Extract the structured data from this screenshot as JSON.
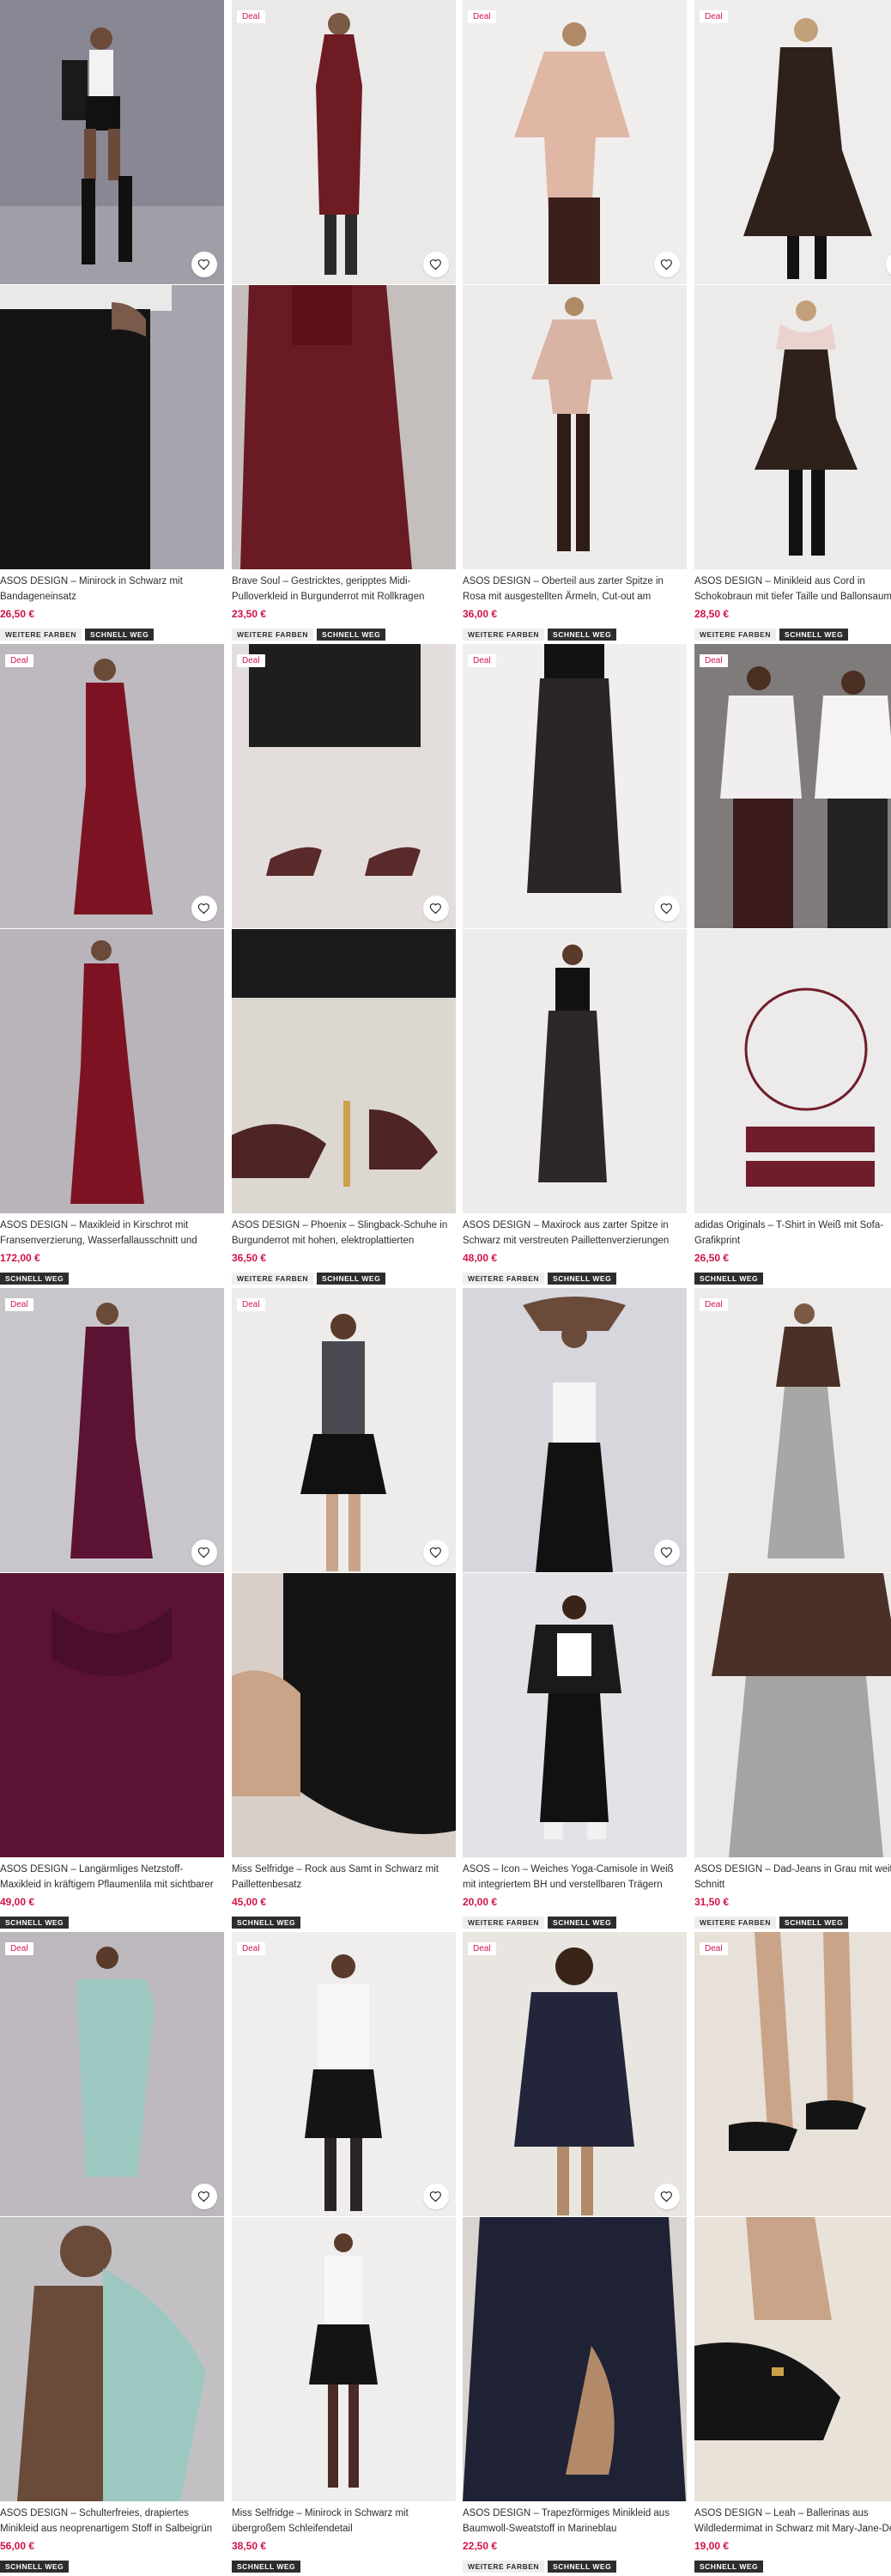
{
  "labels": {
    "deal": "Deal",
    "more_colors": "WEITERE FARBEN",
    "quick_view": "SCHNELL WEG"
  },
  "products": [
    {
      "title": "ASOS DESIGN – Minirock in Schwarz mit Bandageneinsatz",
      "price": "26,50 €",
      "deal": false,
      "more_colors": true,
      "quick": true
    },
    {
      "title": "Brave Soul – Gestricktes, geripptes Midi-Pulloverkleid in Burgunderrot mit Rollkragen",
      "price": "23,50 €",
      "deal": true,
      "more_colors": true,
      "quick": true
    },
    {
      "title": "ASOS DESIGN – Oberteil aus zarter Spitze in Rosa mit ausgestellten Ärmeln, Cut-out am Rücken und...",
      "price": "36,00 €",
      "deal": true,
      "more_colors": true,
      "quick": true
    },
    {
      "title": "ASOS DESIGN – Minikleid aus Cord in Schokobraun mit tiefer Taille und Ballonsaum",
      "price": "28,50 €",
      "deal": true,
      "more_colors": true,
      "quick": true
    },
    {
      "title": "ASOS DESIGN – Maxikleid in Kirschrot mit Fransenverzierung, Wasserfallausschnitt und Bralet...",
      "price": "172,00 €",
      "deal": true,
      "more_colors": false,
      "quick": true
    },
    {
      "title": "ASOS DESIGN – Phoenix – Slingback-Schuhe in Burgunderrot mit hohen, elektroplattierten Absätzen",
      "price": "36,50 €",
      "deal": true,
      "more_colors": true,
      "quick": true
    },
    {
      "title": "ASOS DESIGN – Maxirock aus zarter Spitze in Schwarz mit verstreuten Paillettenverzierungen",
      "price": "48,00 €",
      "deal": true,
      "more_colors": true,
      "quick": true
    },
    {
      "title": "adidas Originals – T-Shirt in Weiß mit Sofa-Grafikprint",
      "price": "26,50 €",
      "deal": true,
      "more_colors": false,
      "quick": true
    },
    {
      "title": "ASOS DESIGN – Langärmliges Netzstoff-Maxikleid in kräftigem Pflaumenlila mit sichtbarer Ziernaht",
      "price": "49,00 €",
      "deal": true,
      "more_colors": false,
      "quick": true
    },
    {
      "title": "Miss Selfridge – Rock aus Samt in Schwarz mit Paillettenbesatz",
      "price": "45,00 €",
      "deal": true,
      "more_colors": false,
      "quick": true
    },
    {
      "title": "ASOS – Icon – Weiches Yoga-Camisole in Weiß mit integriertem BH und verstellbaren Trägern",
      "price": "20,00 €",
      "deal": false,
      "more_colors": true,
      "quick": true
    },
    {
      "title": "ASOS DESIGN – Dad-Jeans in Grau mit weiter Schnitt",
      "price": "31,50 €",
      "deal": true,
      "more_colors": true,
      "quick": true
    },
    {
      "title": "ASOS DESIGN – Schulterfreies, drapiertes Minikleid aus neoprenartigem Stoff in Salbeigrün mit...",
      "price": "56,00 €",
      "deal": true,
      "more_colors": false,
      "quick": true
    },
    {
      "title": "Miss Selfridge – Minirock in Schwarz mit übergroßem Schleifendetail",
      "price": "38,50 €",
      "deal": true,
      "more_colors": false,
      "quick": true
    },
    {
      "title": "ASOS DESIGN – Trapezförmiges Minikleid aus Baumwoll-Sweatstoff in Marineblau",
      "price": "22,50 €",
      "deal": true,
      "more_colors": true,
      "quick": true
    },
    {
      "title": "ASOS DESIGN – Leah – Ballerinas aus Wildledermimat in Schwarz mit Mary-Jane-Desi...",
      "price": "19,00 €",
      "deal": true,
      "more_colors": false,
      "quick": true
    }
  ],
  "colors": {
    "price": "#d01345",
    "deal_text": "#d0164e",
    "tag_dark": "#2d2d2d",
    "tag_light": "#eeeeee"
  }
}
